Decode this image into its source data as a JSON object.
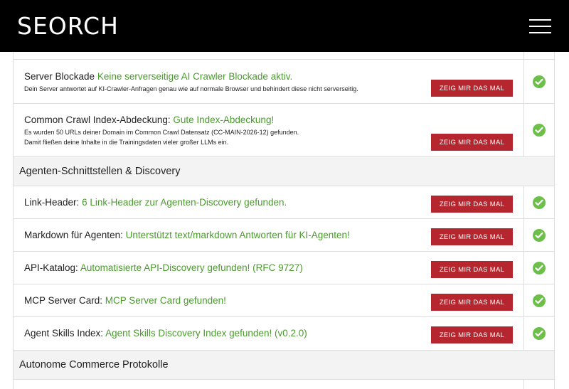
{
  "header": {
    "logo": "SEORCH",
    "menu_icon": "hamburger-menu-icon"
  },
  "colors": {
    "header_bg": "#000000",
    "result_green": "#4a9a2e",
    "button_red": "#b5262e",
    "check_green": "#6cc04a",
    "section_bg": "#f3f3f3"
  },
  "rows_top": [
    {
      "label": "Server Blockade",
      "result": "Keine serverseitige AI Crawler Blockade aktiv.",
      "desc1": "Dein Server antwortet auf KI-Crawler-Anfragen genau wie auf normale Browser und behindert diese nicht serverseitig.",
      "button": "ZEIG MIR DAS MAL",
      "status_icon": "check-circle-icon"
    },
    {
      "label": "Common Crawl Index-Abdeckung:",
      "result": "Gute Index-Abdeckung!",
      "desc1": "Es wurden 50 URLs deiner Domain im Common Crawl Datensatz (CC-MAIN-2026-12) gefunden.",
      "desc2": "Damit fließen deine Inhalte in die Trainingsdaten vieler großer LLMs ein.",
      "button": "ZEIG MIR DAS MAL",
      "status_icon": "check-circle-icon"
    }
  ],
  "sections": {
    "agents": "Agenten-Schnittstellen & Discovery",
    "commerce": "Autonome Commerce Protokolle"
  },
  "rows_agents": [
    {
      "label": "Link-Header:",
      "result": "6 Link-Header zur Agenten-Discovery gefunden.",
      "button": "ZEIG MIR DAS MAL"
    },
    {
      "label": "Markdown für Agenten:",
      "result": "Unterstützt text/markdown Antworten für KI-Agenten!",
      "button": "ZEIG MIR DAS MAL"
    },
    {
      "label": "API-Katalog:",
      "result": "Automatisierte API-Discovery gefunden! (RFC 9727)",
      "button": "ZEIG MIR DAS MAL"
    },
    {
      "label": "MCP Server Card:",
      "result": "MCP Server Card gefunden!",
      "button": "ZEIG MIR DAS MAL"
    },
    {
      "label": "Agent Skills Index:",
      "result": "Agent Skills Discovery Index gefunden! (v0.2.0)",
      "button": "ZEIG MIR DAS MAL"
    }
  ]
}
